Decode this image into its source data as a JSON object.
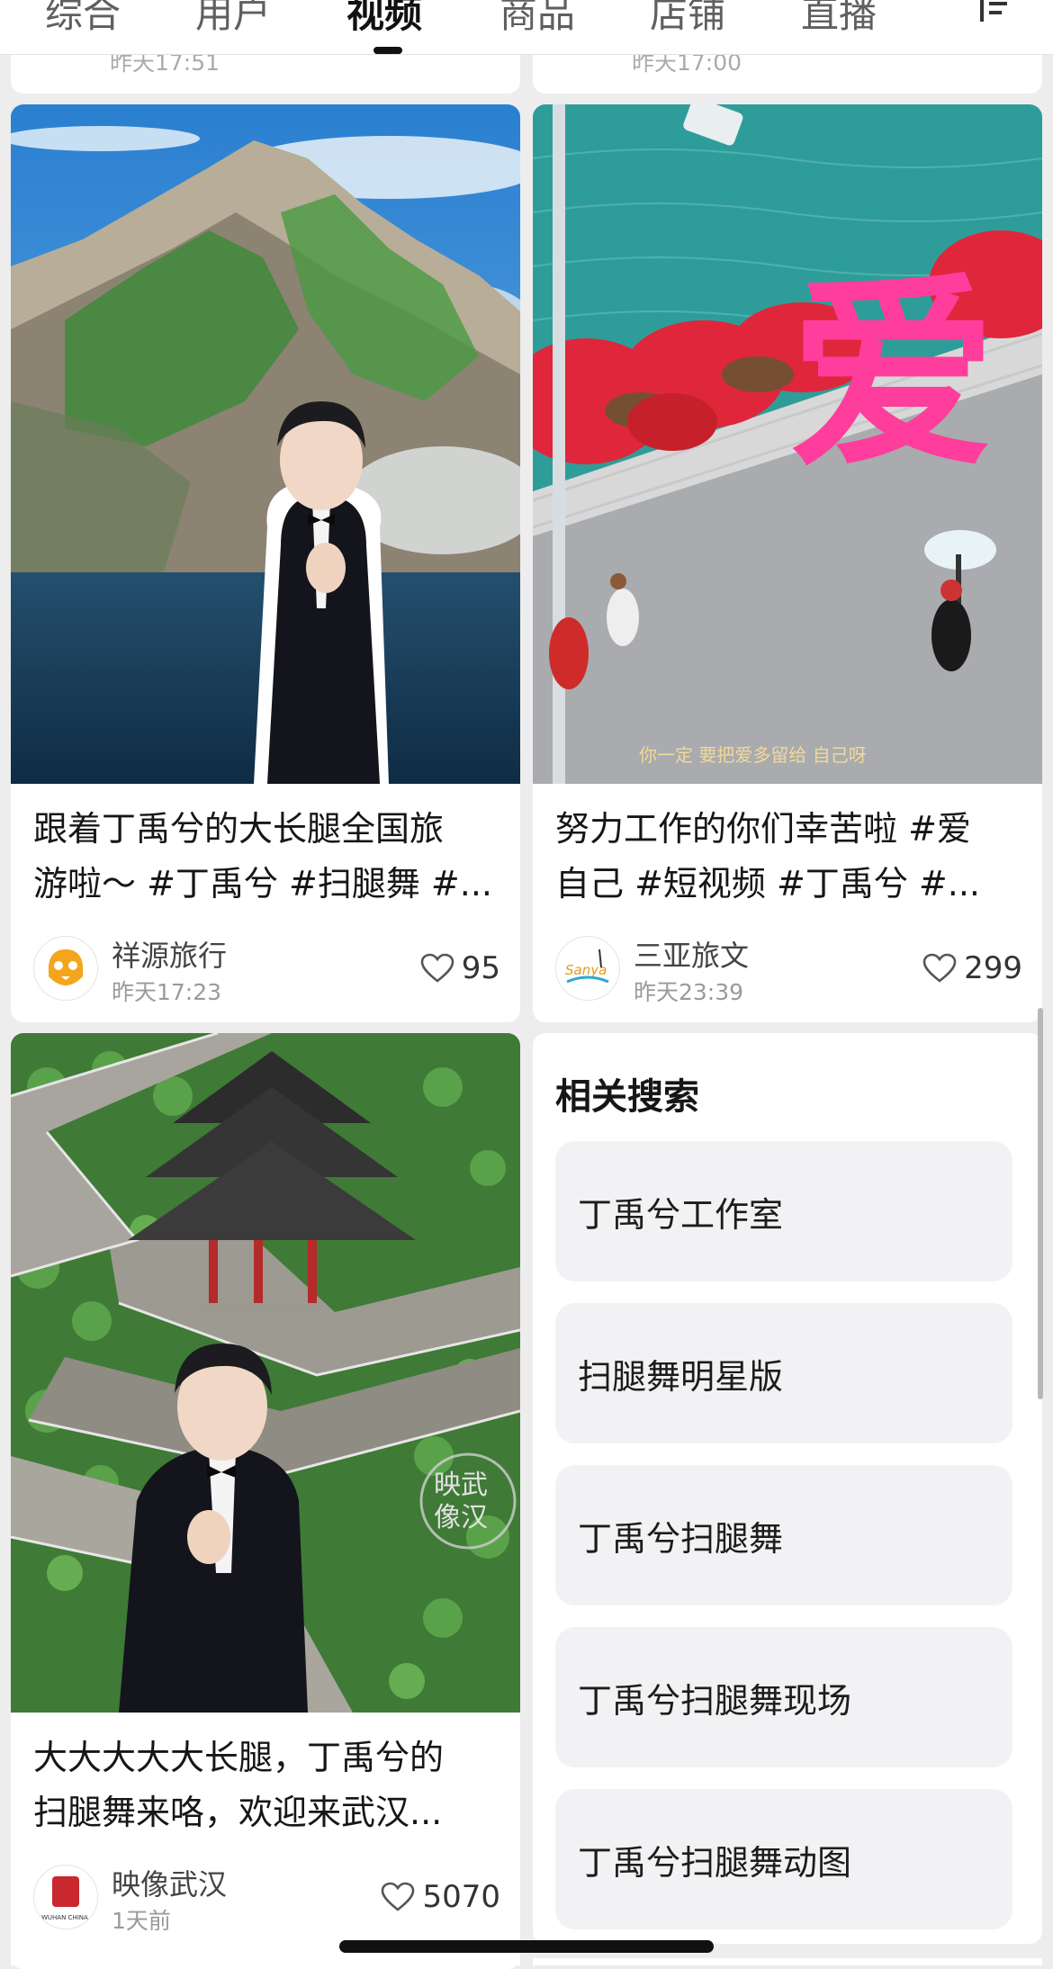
{
  "tabs": [
    {
      "label": "综合"
    },
    {
      "label": "用户"
    },
    {
      "label": "视频"
    },
    {
      "label": "商品"
    },
    {
      "label": "店铺"
    },
    {
      "label": "直播"
    }
  ],
  "active_tab": "视频",
  "top_row": [
    {
      "time": "昨天17:51"
    },
    {
      "time": "昨天17:00"
    }
  ],
  "videos": [
    {
      "title_lines": [
        "跟着丁禹兮的大长腿全国旅",
        "游啦～ #丁禹兮 #扫腿舞 #..."
      ],
      "author": "祥源旅行",
      "time": "昨天17:23",
      "likes": "95"
    },
    {
      "title_lines": [
        "努力工作的你们幸苦啦 #爱",
        "自己 #短视频  #丁禹兮 #..."
      ],
      "author": "三亚旅文",
      "time": "昨天23:39",
      "likes": "299"
    },
    {
      "title_lines": [
        "大大大大大长腿，丁禹兮的",
        "扫腿舞来咯，欢迎来武汉..."
      ],
      "author": "映像武汉",
      "time": "1天前",
      "likes": "5070"
    }
  ],
  "thumb_text": {
    "love_char": "爱",
    "sanya_caption": "你一定  要把爱多留给 自己呀",
    "wuhan_stamp": [
      "映武",
      "像汉"
    ],
    "wuhan_logo": "WUHAN CHINA",
    "sanya_logo": "Sanya"
  },
  "related": {
    "title": "相关搜索",
    "items": [
      "丁禹兮工作室",
      "扫腿舞明星版",
      "丁禹兮扫腿舞",
      "丁禹兮扫腿舞现场",
      "丁禹兮扫腿舞动图"
    ]
  },
  "colors": {
    "background": "#ededed",
    "card": "#ffffff",
    "related_item": "#f2f2f4",
    "active_text": "#111111",
    "inactive_text": "#5f5f5f"
  }
}
